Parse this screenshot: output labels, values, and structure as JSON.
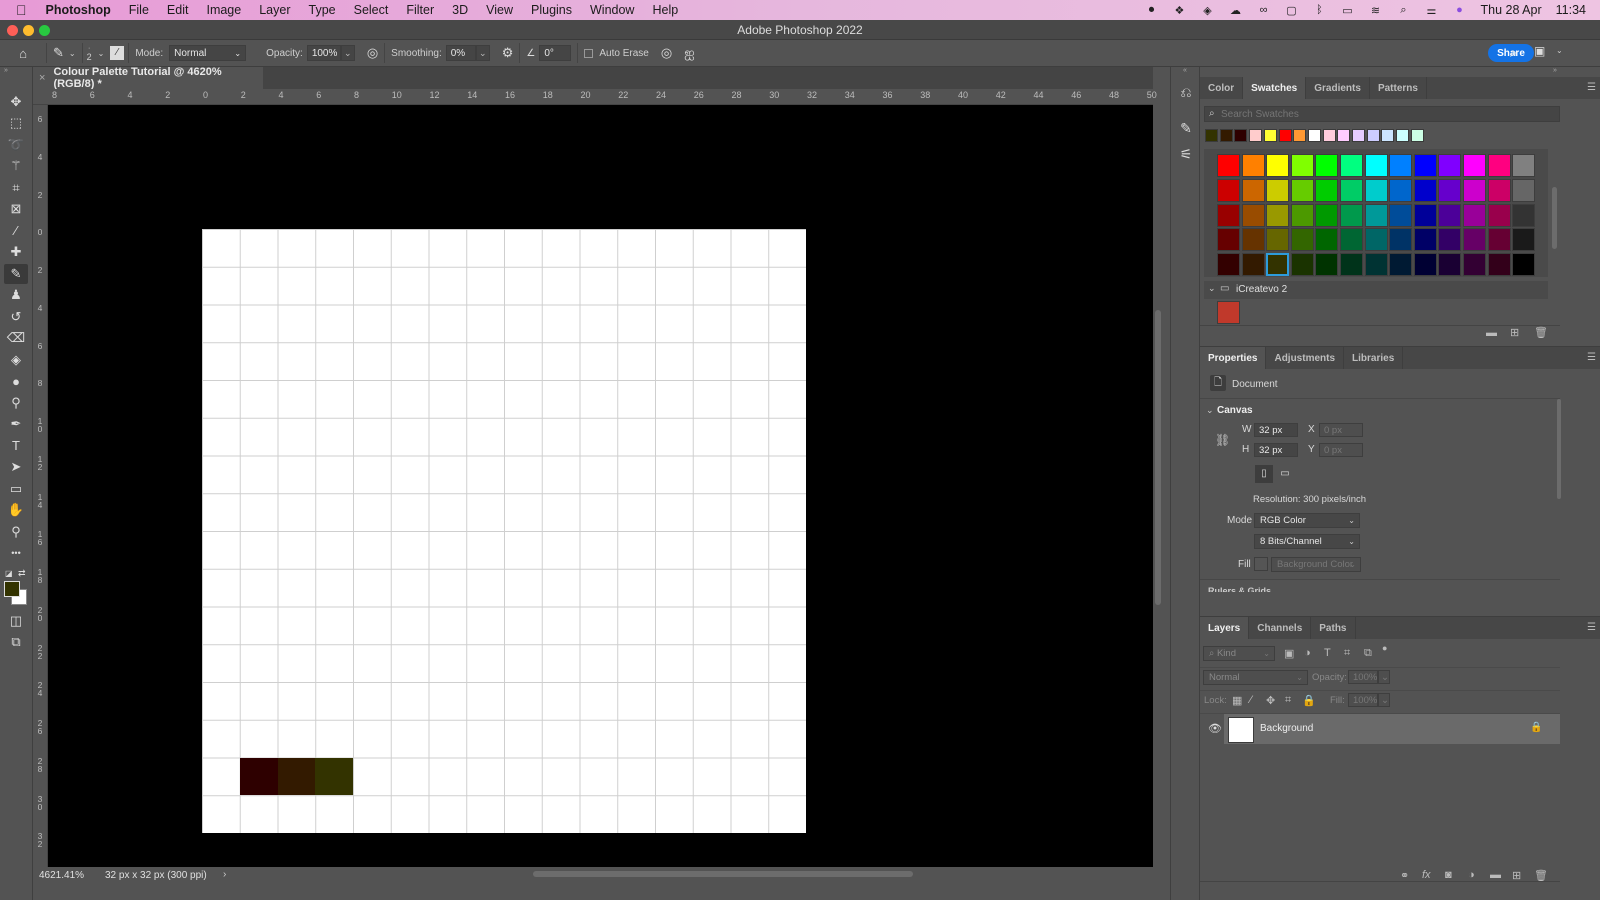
{
  "menubar": {
    "apple": "",
    "app": "Photoshop",
    "items": [
      "File",
      "Edit",
      "Image",
      "Layer",
      "Type",
      "Select",
      "Filter",
      "3D",
      "View",
      "Plugins",
      "Window",
      "Help"
    ],
    "date": "Thu 28 Apr",
    "time": "11:34",
    "status_icons": [
      "record-icon",
      "dropbox-icon",
      "layers-stack-icon",
      "cloud-icon",
      "creative-cloud-icon",
      "calendar-icon",
      "bluetooth-icon",
      "battery-icon",
      "wifi-icon",
      "spotlight-icon",
      "control-center-icon",
      "siri-icon"
    ]
  },
  "window": {
    "title": "Adobe Photoshop 2022"
  },
  "options": {
    "brush_size": "2",
    "mode_label": "Mode:",
    "mode_value": "Normal",
    "opacity_label": "Opacity:",
    "opacity_value": "100%",
    "smoothing_label": "Smoothing:",
    "smoothing_value": "0%",
    "angle_value": "0°",
    "auto_erase_label": "Auto Erase",
    "auto_erase_checked": false,
    "share_label": "Share"
  },
  "document": {
    "tab_title": "Colour Palette Tutorial @ 4620% (RGB/8) *",
    "zoom": "4621.41%",
    "info": "32 px x 32 px (300 ppi)",
    "grid_size": 16,
    "painted_cells": [
      {
        "col": 1,
        "row": 14,
        "color": "#2e0000"
      },
      {
        "col": 2,
        "row": 14,
        "color": "#331a00"
      },
      {
        "col": 3,
        "row": 14,
        "color": "#333300"
      }
    ]
  },
  "rulers": {
    "top": [
      "8",
      "6",
      "4",
      "2",
      "0",
      "2",
      "4",
      "6",
      "8",
      "10",
      "12",
      "14",
      "16",
      "18",
      "20",
      "22",
      "24",
      "26",
      "28",
      "30",
      "32",
      "34",
      "36",
      "38",
      "40",
      "42",
      "44",
      "46",
      "48",
      "50"
    ],
    "left": [
      "6",
      "4",
      "2",
      "0",
      "2",
      "4",
      "6",
      "8",
      "10",
      "12",
      "14",
      "16",
      "18",
      "20",
      "22",
      "24",
      "26",
      "28",
      "30",
      "32"
    ]
  },
  "tools": [
    {
      "name": "move-tool",
      "glyph": "✥"
    },
    {
      "name": "marquee-tool",
      "glyph": "⬚"
    },
    {
      "name": "lasso-tool",
      "glyph": "➰"
    },
    {
      "name": "magic-wand-tool",
      "glyph": "⚚"
    },
    {
      "name": "crop-tool",
      "glyph": "⌗"
    },
    {
      "name": "frame-tool",
      "glyph": "⊠"
    },
    {
      "name": "eyedropper-tool",
      "glyph": "⁄"
    },
    {
      "name": "healing-brush-tool",
      "glyph": "✚"
    },
    {
      "name": "pencil-tool",
      "glyph": "✎",
      "active": true
    },
    {
      "name": "clone-stamp-tool",
      "glyph": "♟"
    },
    {
      "name": "history-brush-tool",
      "glyph": "↺"
    },
    {
      "name": "eraser-tool",
      "glyph": "⌫"
    },
    {
      "name": "paint-bucket-tool",
      "glyph": "◈"
    },
    {
      "name": "blur-tool",
      "glyph": "●"
    },
    {
      "name": "dodge-tool",
      "glyph": "⚲"
    },
    {
      "name": "pen-tool",
      "glyph": "✒"
    },
    {
      "name": "type-tool",
      "glyph": "T"
    },
    {
      "name": "path-selection-tool",
      "glyph": "➤"
    },
    {
      "name": "rectangle-tool",
      "glyph": "▭"
    },
    {
      "name": "hand-tool",
      "glyph": "✋"
    },
    {
      "name": "zoom-tool",
      "glyph": "⚲"
    },
    {
      "name": "more-tools",
      "glyph": "•••"
    }
  ],
  "colors": {
    "foreground": "#333300",
    "background": "#ffffff",
    "accent": "#1473e6"
  },
  "swatches_panel": {
    "tabs": [
      "Color",
      "Swatches",
      "Gradients",
      "Patterns"
    ],
    "active_tab": "Swatches",
    "search_placeholder": "Search Swatches",
    "recent": [
      "#333300",
      "#331a00",
      "#2e0000",
      "#ffcccc",
      "#ffff33",
      "#ff0000",
      "#ff9933",
      "#ffffff",
      "#ffccdd",
      "#ffccff",
      "#e5ccff",
      "#ccccff",
      "#cce5ff",
      "#ccffff",
      "#ccffe5"
    ],
    "grid": [
      [
        "#ff0000",
        "#ff8000",
        "#ffff00",
        "#80ff00",
        "#00ff00",
        "#00ff80",
        "#00ffff",
        "#0080ff",
        "#0000ff",
        "#8000ff",
        "#ff00ff",
        "#ff0080",
        "#808080"
      ],
      [
        "#cc0000",
        "#cc6600",
        "#cccc00",
        "#66cc00",
        "#00cc00",
        "#00cc66",
        "#00cccc",
        "#0066cc",
        "#0000cc",
        "#6600cc",
        "#cc00cc",
        "#cc0066",
        "#666666"
      ],
      [
        "#990000",
        "#994c00",
        "#999900",
        "#4c9900",
        "#009900",
        "#00994c",
        "#009999",
        "#004c99",
        "#000099",
        "#4c0099",
        "#990099",
        "#99004c",
        "#333333"
      ],
      [
        "#660000",
        "#663300",
        "#666600",
        "#336600",
        "#006600",
        "#006633",
        "#006666",
        "#003366",
        "#000066",
        "#330066",
        "#660066",
        "#660033",
        "#1a1a1a"
      ],
      [
        "#330000",
        "#331a00",
        "#333300",
        "#1a3300",
        "#003300",
        "#00331a",
        "#003333",
        "#001a33",
        "#000033",
        "#1a0033",
        "#330033",
        "#33001a",
        "#000000"
      ]
    ],
    "selected_swatch": {
      "row": 4,
      "col": 2
    },
    "group_name": "iCreatevo 2",
    "group_swatches": [
      "#c0392b"
    ]
  },
  "properties_panel": {
    "tabs": [
      "Properties",
      "Adjustments",
      "Libraries"
    ],
    "active_tab": "Properties",
    "type_label": "Document",
    "section": "Canvas",
    "w_label": "W",
    "w_value": "32 px",
    "h_label": "H",
    "h_value": "32 px",
    "x_label": "X",
    "x_value": "0 px",
    "y_label": "Y",
    "y_value": "0 px",
    "resolution": "Resolution: 300 pixels/inch",
    "mode_label": "Mode",
    "mode_value": "RGB Color",
    "bits_value": "8 Bits/Channel",
    "fill_label": "Fill",
    "fill_value": "Background Color",
    "next_section": "Rulers & Grids"
  },
  "layers_panel": {
    "tabs": [
      "Layers",
      "Channels",
      "Paths"
    ],
    "active_tab": "Layers",
    "kind_placeholder": "Kind",
    "blend_mode": "Normal",
    "opacity_label": "Opacity:",
    "opacity_value": "100%",
    "lock_label": "Lock:",
    "fill_label": "Fill:",
    "fill_value": "100%",
    "layers": [
      {
        "name": "Background",
        "visible": true,
        "locked": true
      }
    ]
  }
}
